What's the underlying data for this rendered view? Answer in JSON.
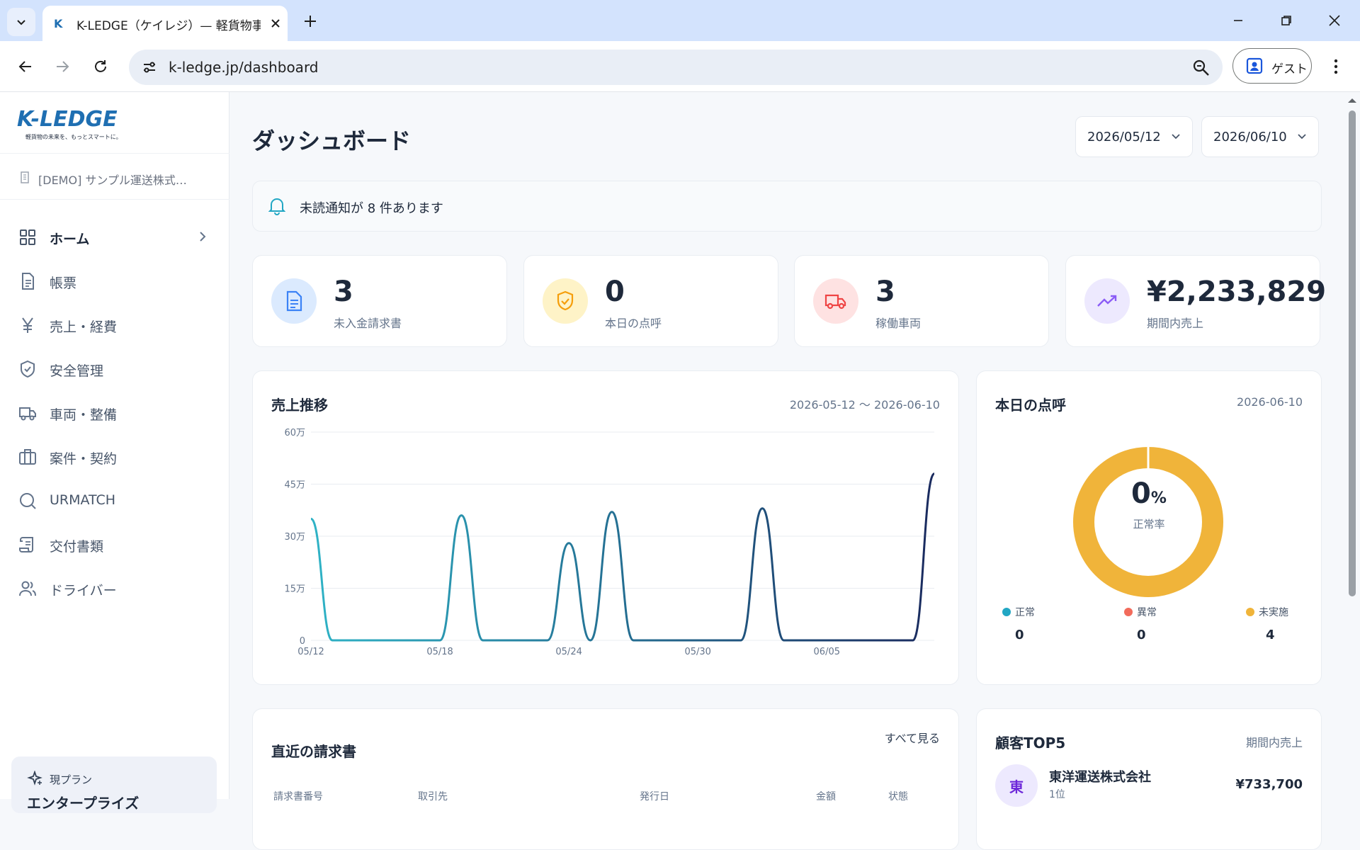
{
  "browser": {
    "tab_title": "K-LEDGE（ケイレジ）— 軽貨物事",
    "url": "k-ledge.jp/dashboard",
    "profile_label": "ゲスト"
  },
  "sidebar": {
    "logo_text": "K-LEDGE",
    "logo_tagline": "軽貨物の未来を、もっとスマートに。",
    "company": "[DEMO] サンプル運送株式…",
    "items": [
      {
        "label": "ホーム",
        "icon": "grid-icon"
      },
      {
        "label": "帳票",
        "icon": "document-icon"
      },
      {
        "label": "売上・経費",
        "icon": "yen-icon"
      },
      {
        "label": "安全管理",
        "icon": "shield-icon"
      },
      {
        "label": "車両・整備",
        "icon": "truck-icon"
      },
      {
        "label": "案件・契約",
        "icon": "briefcase-icon"
      },
      {
        "label": "URMATCH",
        "icon": "search-icon"
      },
      {
        "label": "交付書類",
        "icon": "scroll-icon"
      },
      {
        "label": "ドライバー",
        "icon": "users-icon"
      }
    ],
    "plan_label": "現プラン",
    "plan_name": "エンタープライズ"
  },
  "header": {
    "title": "ダッシュボード",
    "date_from": "2026/05/12",
    "date_to": "2026/06/10"
  },
  "notice": {
    "text": "未読通知が 8 件あります"
  },
  "stats": [
    {
      "value": "3",
      "label": "未入金請求書",
      "icon": "invoice-icon",
      "color": "#3b82f6"
    },
    {
      "value": "0",
      "label": "本日の点呼",
      "icon": "shield-check-icon",
      "color": "#f59e0b"
    },
    {
      "value": "3",
      "label": "稼働車両",
      "icon": "truck-icon",
      "color": "#ef4444"
    },
    {
      "value": "¥2,233,829",
      "label": "期間内売上",
      "icon": "trend-up-icon",
      "color": "#8b5cf6"
    }
  ],
  "sales_card": {
    "title": "売上推移",
    "range": "2026-05-12 〜 2026-06-10"
  },
  "rollcall_card": {
    "title": "本日の点呼",
    "date": "2026-06-10",
    "rate_value": "0",
    "rate_unit": "%",
    "rate_label": "正常率",
    "legend": [
      {
        "label": "正常",
        "value": "0",
        "color": "#22a7c4"
      },
      {
        "label": "異常",
        "value": "0",
        "color": "#f26b5b"
      },
      {
        "label": "未実施",
        "value": "4",
        "color": "#f0b43a"
      }
    ]
  },
  "invoices_card": {
    "title": "直近の請求書",
    "view_all": "すべて見る",
    "columns": [
      "請求書番号",
      "取引先",
      "発行日",
      "金額",
      "状態"
    ]
  },
  "customers_card": {
    "title": "顧客TOP5",
    "meta": "期間内売上",
    "rows": [
      {
        "avatar": "東",
        "name": "東洋運送株式会社",
        "rank": "1位",
        "amount": "¥733,700"
      }
    ]
  },
  "chart_data": {
    "type": "line",
    "title": "売上推移",
    "x": [
      "05/12",
      "05/13",
      "05/14",
      "05/15",
      "05/16",
      "05/17",
      "05/18",
      "05/19",
      "05/20",
      "05/21",
      "05/22",
      "05/23",
      "05/24",
      "05/25",
      "05/26",
      "05/27",
      "05/28",
      "05/29",
      "05/30",
      "05/31",
      "06/01",
      "06/02",
      "06/03",
      "06/04",
      "06/05",
      "06/06",
      "06/07",
      "06/08",
      "06/09",
      "06/10"
    ],
    "series": [
      {
        "values": [
          350000,
          0,
          0,
          0,
          0,
          0,
          0,
          360000,
          0,
          0,
          0,
          0,
          280000,
          0,
          370000,
          0,
          0,
          0,
          0,
          0,
          0,
          380000,
          0,
          0,
          0,
          0,
          0,
          0,
          0,
          480000
        ]
      }
    ],
    "x_ticks": [
      "05/12",
      "05/18",
      "05/24",
      "05/30",
      "06/05"
    ],
    "y_ticks": [
      "0",
      "15万",
      "30万",
      "45万",
      "60万"
    ],
    "ylim": [
      0,
      600000
    ],
    "grid": true,
    "colors_start": "#2fb3c6",
    "colors_end": "#1a2a5e"
  }
}
